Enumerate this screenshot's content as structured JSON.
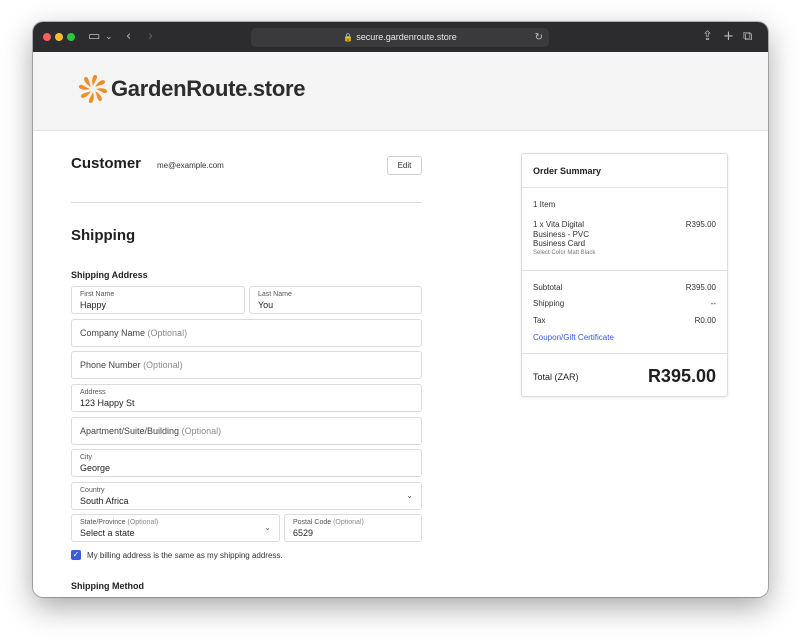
{
  "browser": {
    "url": "secure.gardenroute.store"
  },
  "brand": {
    "name": "GardenRoute.store",
    "accent_color": "#f28c28"
  },
  "customer": {
    "title": "Customer",
    "email": "me@example.com",
    "edit_label": "Edit"
  },
  "shipping": {
    "title": "Shipping",
    "address_label": "Shipping Address",
    "first_name_label": "First Name",
    "first_name_value": "Happy",
    "last_name_label": "Last Name",
    "last_name_value": "You",
    "company_placeholder": "Company Name",
    "phone_placeholder": "Phone Number",
    "optional": "(Optional)",
    "address_label2": "Address",
    "address_value": "123 Happy St",
    "apartment_placeholder": "Apartment/Suite/Building",
    "city_label": "City",
    "city_value": "George",
    "country_label": "Country",
    "country_value": "South Africa",
    "state_label": "State/Province",
    "state_value": "Select a state",
    "postal_label": "Postal Code",
    "postal_value": "6529",
    "billing_same_label": "My billing address is the same as my shipping address.",
    "billing_same_checked": true,
    "method_label": "Shipping Method"
  },
  "summary": {
    "title": "Order Summary",
    "item_count": "1 Item",
    "item_name": "1 x Vita Digital Business - PVC Business Card",
    "item_price": "R395.00",
    "item_option": "Select Color Matt Black",
    "subtotal_label": "Subtotal",
    "subtotal_value": "R395.00",
    "shipping_label": "Shipping",
    "shipping_value": "--",
    "tax_label": "Tax",
    "tax_value": "R0.00",
    "coupon_label": "Coupon/Gift Certificate",
    "total_label": "Total (ZAR)",
    "total_value": "R395.00"
  }
}
